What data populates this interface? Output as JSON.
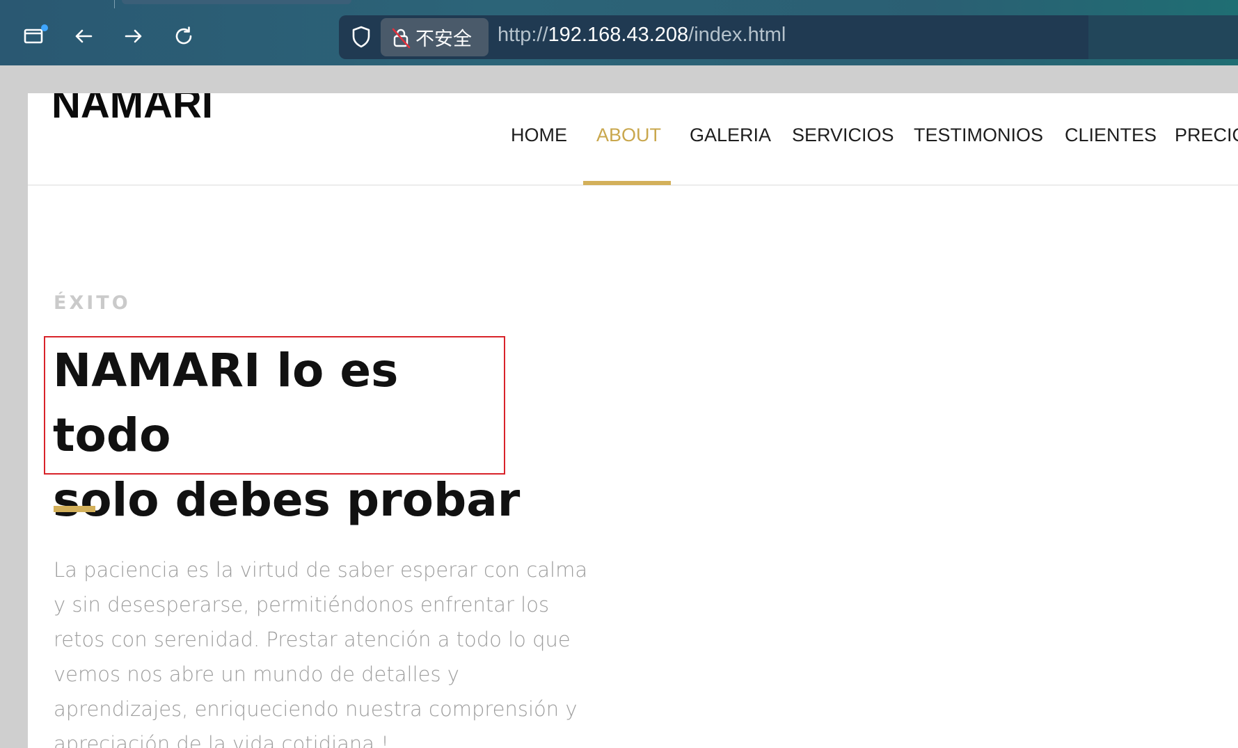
{
  "browser": {
    "security_label": "不安全",
    "url_scheme": "http://",
    "url_host": "192.168.43.208",
    "url_path": "/index.html"
  },
  "site": {
    "logo": "NAMARI",
    "nav": [
      {
        "label": "HOME",
        "active": false
      },
      {
        "label": "ABOUT",
        "active": true
      },
      {
        "label": "GALERIA",
        "active": false
      },
      {
        "label": "SERVICIOS",
        "active": false
      },
      {
        "label": "TESTIMONIOS",
        "active": false
      },
      {
        "label": "CLIENTES",
        "active": false
      },
      {
        "label": "PRECIO",
        "active": false
      }
    ],
    "accent_color": "#d3b05a"
  },
  "about": {
    "eyebrow": "ÉXITO",
    "headline_line1": "NAMARI lo es todo",
    "headline_line2": "solo debes probar",
    "paragraph": "La paciencia es la virtud de saber esperar con calma y sin desesperarse, permitiéndonos enfrentar los retos con serenidad. Prestar atención a todo lo que vemos nos abre un mundo de detalles y aprendizajes, enriqueciendo nuestra comprensión y apreciación de la vida cotidiana !"
  }
}
